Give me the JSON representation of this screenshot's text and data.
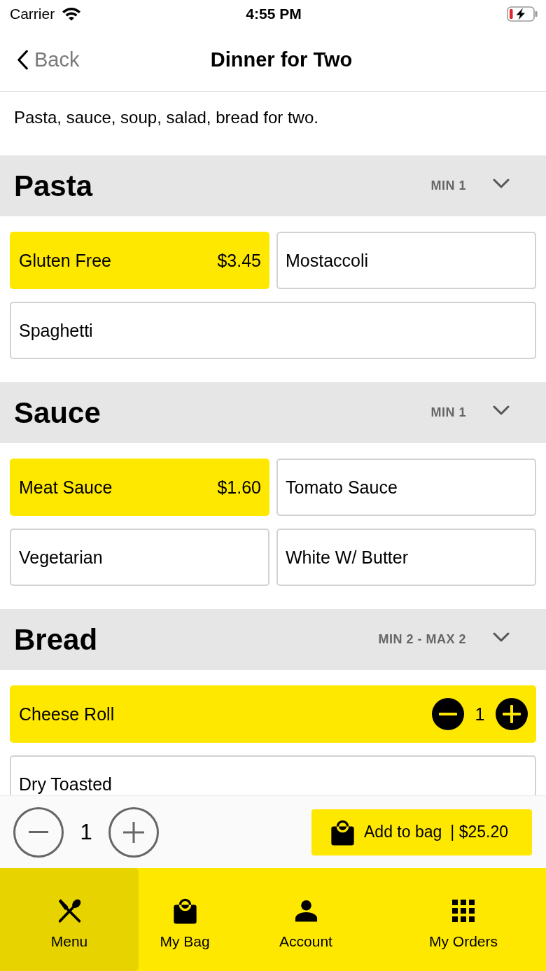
{
  "status_bar": {
    "carrier": "Carrier",
    "time": "4:55 PM",
    "charging": true
  },
  "nav": {
    "back_label": "Back",
    "title": "Dinner for Two"
  },
  "description": "Pasta, sauce, soup, salad, bread for two.",
  "sections": [
    {
      "title": "Pasta",
      "rule": "MIN 1",
      "expanded": true,
      "options": [
        {
          "kind": "choice",
          "name": "Gluten Free",
          "price": "$3.45",
          "selected": true
        },
        {
          "kind": "choice",
          "name": "Mostaccoli",
          "selected": false
        },
        {
          "kind": "choice",
          "name": "Spaghetti",
          "selected": false
        }
      ]
    },
    {
      "title": "Sauce",
      "rule": "MIN 1",
      "expanded": true,
      "options": [
        {
          "kind": "choice",
          "name": "Meat Sauce",
          "price": "$1.60",
          "selected": true
        },
        {
          "kind": "choice",
          "name": "Tomato Sauce",
          "selected": false
        },
        {
          "kind": "choice",
          "name": "Vegetarian",
          "selected": false
        },
        {
          "kind": "choice",
          "name": "White W/ Butter",
          "selected": false
        }
      ]
    },
    {
      "title": "Bread",
      "rule": "MIN 2 - MAX 2",
      "expanded": true,
      "options": [
        {
          "kind": "counter",
          "name": "Cheese Roll",
          "selected": true,
          "quantity": "1"
        },
        {
          "kind": "counter",
          "name": "Dry Toasted",
          "selected": false
        }
      ]
    }
  ],
  "order_bar": {
    "quantity": "1",
    "button_label": "Add to bag",
    "total": "| $25.20"
  },
  "tab_bar": [
    {
      "label": "Menu",
      "selected": true
    },
    {
      "label": "My Bag",
      "selected": false
    },
    {
      "label": "Account",
      "selected": false
    },
    {
      "label": "My Orders",
      "selected": false
    }
  ]
}
